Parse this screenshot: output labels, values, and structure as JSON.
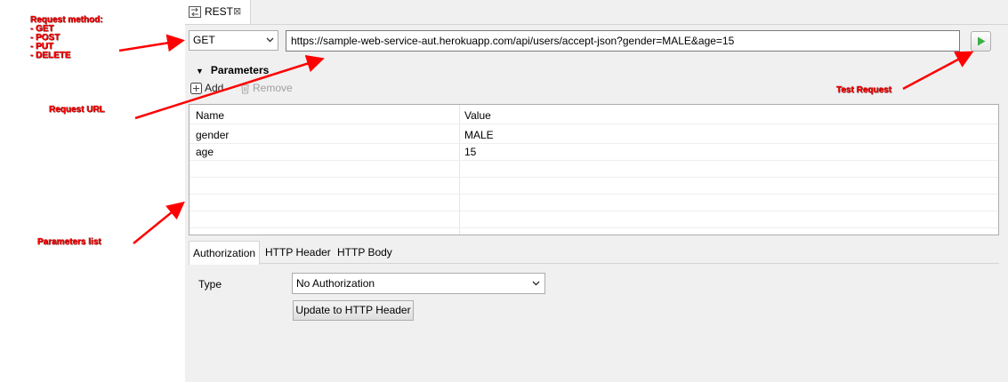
{
  "tab": {
    "title": "REST",
    "close_symbol": "⊠"
  },
  "request": {
    "method": "GET",
    "url": "https://sample-web-service-aut.herokuapp.com/api/users/accept-json?gender=MALE&age=15"
  },
  "parameters": {
    "title": "Parameters",
    "add_label": "Add",
    "remove_label": "Remove",
    "columns": [
      "Name",
      "Value"
    ],
    "rows": [
      {
        "name": "gender",
        "value": "MALE"
      },
      {
        "name": "age",
        "value": "15"
      }
    ]
  },
  "subtabs": [
    "Authorization",
    "HTTP Header",
    "HTTP Body"
  ],
  "authorization": {
    "type_label": "Type",
    "type_value": "No Authorization",
    "update_label": "Update to HTTP Header"
  },
  "annotations": {
    "method_title": "Request method:",
    "method_items": [
      "- GET",
      "- POST",
      "- PUT",
      "- DELETE"
    ],
    "request_url": "Request URL",
    "parameters_list": "Parameters list",
    "test_request": "Test Request"
  },
  "colors": {
    "annotation": "#ff0000",
    "run_icon": "#3cb043"
  },
  "icons": {
    "tab": "rest-request-icon",
    "run": "play-icon",
    "add": "add-icon",
    "remove": "trash-icon",
    "dropdown": "chevron-down-icon"
  }
}
